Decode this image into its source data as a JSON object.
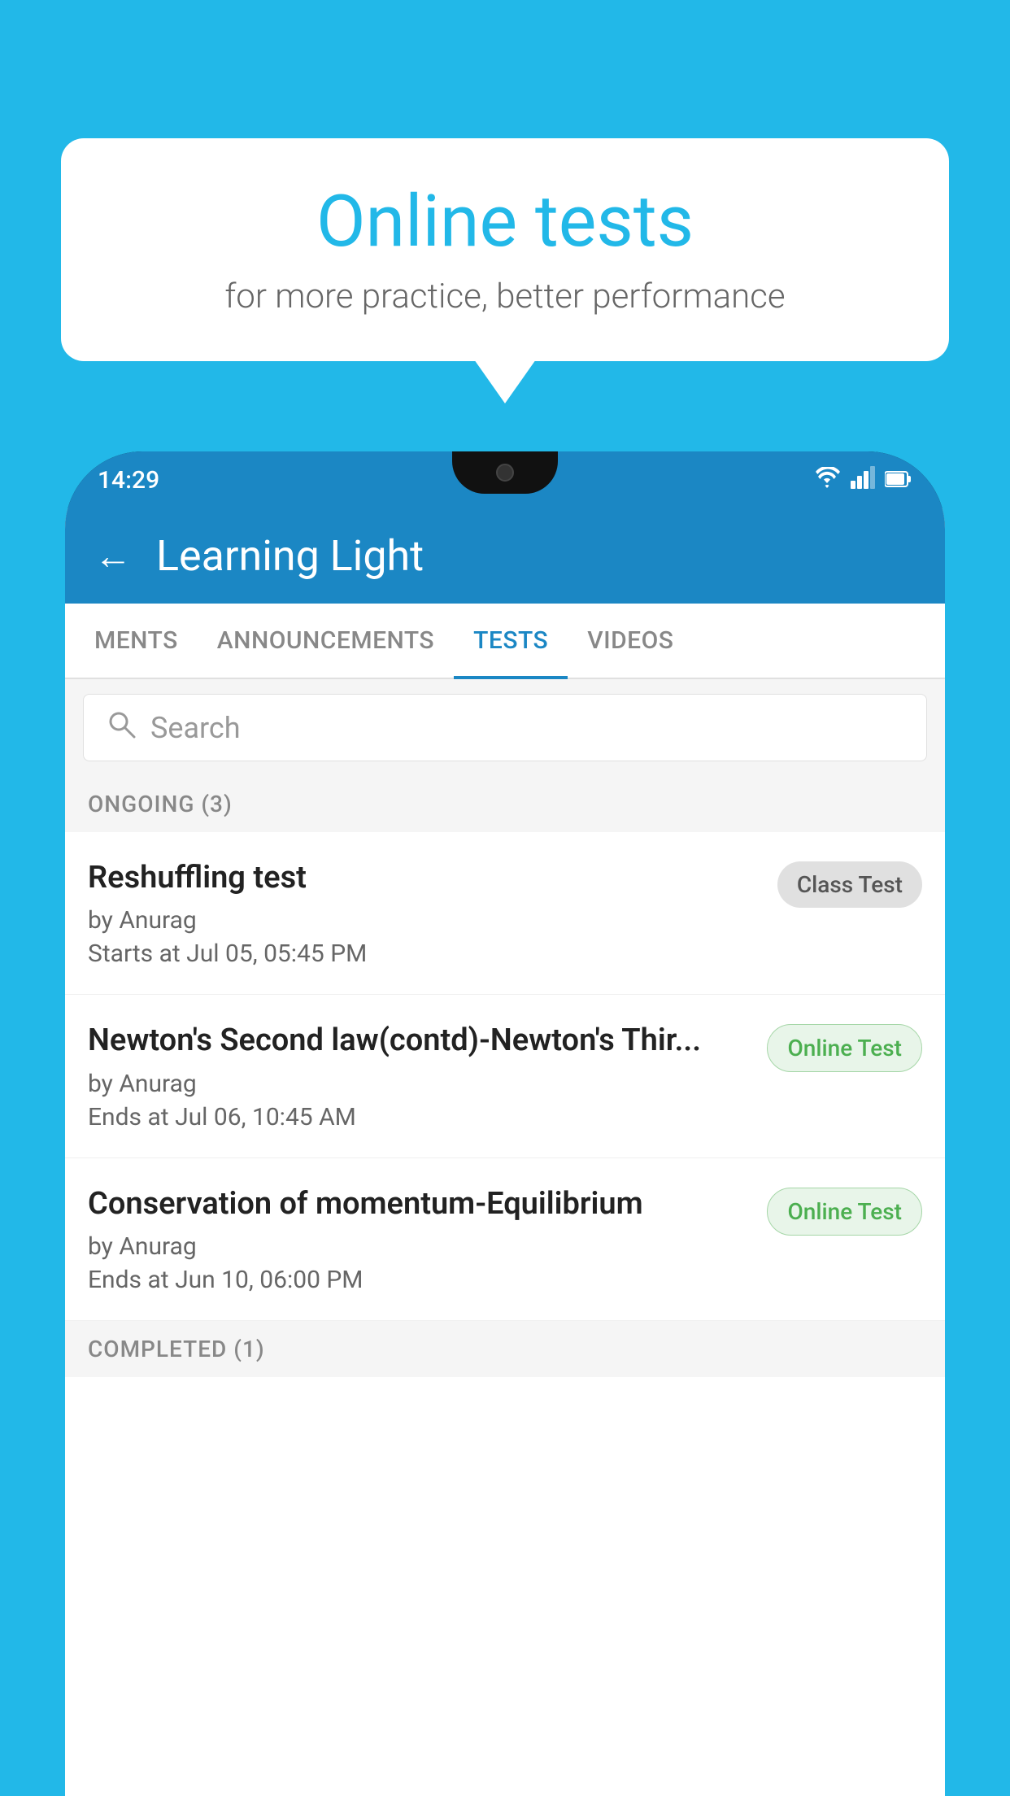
{
  "background_color": "#22b8e8",
  "bubble": {
    "title": "Online tests",
    "subtitle": "for more practice, better performance"
  },
  "status_bar": {
    "time": "14:29",
    "icons": [
      "wifi",
      "signal",
      "battery"
    ]
  },
  "app_header": {
    "title": "Learning Light",
    "back_label": "←"
  },
  "tabs": [
    {
      "label": "MENTS",
      "active": false
    },
    {
      "label": "ANNOUNCEMENTS",
      "active": false
    },
    {
      "label": "TESTS",
      "active": true
    },
    {
      "label": "VIDEOS",
      "active": false
    }
  ],
  "search": {
    "placeholder": "Search"
  },
  "ongoing_section": {
    "label": "ONGOING (3)"
  },
  "tests": [
    {
      "name": "Reshuffling test",
      "author": "by Anurag",
      "time_label": "Starts at",
      "time": "Jul 05, 05:45 PM",
      "badge": "Class Test",
      "badge_type": "class"
    },
    {
      "name": "Newton's Second law(contd)-Newton's Thir...",
      "author": "by Anurag",
      "time_label": "Ends at",
      "time": "Jul 06, 10:45 AM",
      "badge": "Online Test",
      "badge_type": "online"
    },
    {
      "name": "Conservation of momentum-Equilibrium",
      "author": "by Anurag",
      "time_label": "Ends at",
      "time": "Jun 10, 06:00 PM",
      "badge": "Online Test",
      "badge_type": "online"
    }
  ],
  "completed_section": {
    "label": "COMPLETED (1)"
  }
}
